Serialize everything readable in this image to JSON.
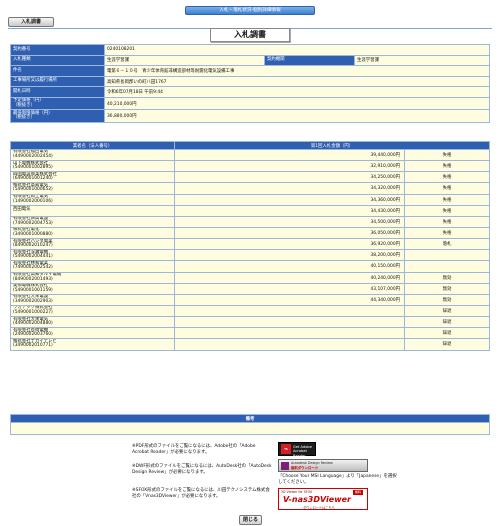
{
  "header": {
    "top_title": "入札・落札状況-個別詳細情報",
    "tab_label": "入札調書",
    "page_title": "入札調書"
  },
  "info": {
    "contract_no": {
      "label": "契約番号",
      "value": "0240108201"
    },
    "bid_method": {
      "label": "入札種類",
      "value": "生涯学習課"
    },
    "dept": {
      "label": "契約機関",
      "value": "生涯学習課"
    },
    "project": {
      "label": "件名",
      "value": "電第６－１０号　青少年体育館非構造部材等耐震化電気設備工事"
    },
    "location": {
      "label": "工事場所又は履行場所",
      "value": "高知県長岡郡いの町八田1767"
    },
    "bid_date": {
      "label": "開札日時",
      "value": "令和6年07月18日 午前9:44"
    },
    "planned_price": {
      "label": "予定価格（円）\n（税抜き）",
      "value": "40,210,000円"
    },
    "min_price": {
      "label": "最低制限価格（円）\n（税抜き）",
      "value": "36,880,000円"
    }
  },
  "bids": {
    "col_name": "業者名（法人番号）",
    "col_amount": "第1回入札金額（円）",
    "rows": [
      {
        "name": "有限会社福西電気",
        "corp": "(4490002002454)",
        "amount": "39,440,000円",
        "result": "失格"
      },
      {
        "name": "山下電機株式会社",
        "corp": "(5490001002895)",
        "amount": "32,910,000円",
        "result": "失格"
      },
      {
        "name": "四国電設興業株式会社",
        "corp": "(6490001001240)",
        "amount": "34,250,000円",
        "result": "失格"
      },
      {
        "name": "株式会社高知電気",
        "corp": "(5490001000652)",
        "amount": "34,320,000円",
        "result": "失格"
      },
      {
        "name": "有限会社岡上電気",
        "corp": "(1490002000106)",
        "amount": "34,360,000円",
        "result": "失格"
      },
      {
        "name": "西田電気",
        "corp": "",
        "amount": "34,430,000円",
        "result": "失格"
      },
      {
        "name": "有限会社興高電設",
        "corp": "(7490002004753)",
        "amount": "34,500,000円",
        "result": "失格"
      },
      {
        "name": "株式会社電化",
        "corp": "(3490001000880)",
        "amount": "36,050,000円",
        "result": "失格"
      },
      {
        "name": "有限会社ハシダ電業",
        "corp": "(8490002010247)",
        "amount": "36,920,000円",
        "result": "落札"
      },
      {
        "name": "有限会社深瀬電機",
        "corp": "(5490002004441)",
        "amount": "38,200,000円",
        "result": ""
      },
      {
        "name": "有限会社林和電業",
        "corp": "(7490002002542)",
        "amount": "40,150,000円",
        "result": ""
      },
      {
        "name": "有限会社高知ダルマ電機",
        "corp": "(8490002001493)",
        "amount": "40,240,000円",
        "result": "無効"
      },
      {
        "name": "美那電機株式会社",
        "corp": "(5490001001159)",
        "amount": "43,107,000円",
        "result": "無効"
      },
      {
        "name": "有限会社大栄電設",
        "corp": "(3490002002903)",
        "amount": "44,340,000円",
        "result": "無効"
      },
      {
        "name": "ワカテック株式会社",
        "corp": "(5490001000227)",
        "amount": "",
        "result": "辞退"
      },
      {
        "name": "有限会社大栄電気",
        "corp": "(4490002004880)",
        "amount": "",
        "result": "辞退"
      },
      {
        "name": "有限会社長崎電機",
        "corp": "(2490002003760)",
        "amount": "",
        "result": "辞退"
      },
      {
        "name": "株式会社ナカイテレビ",
        "corp": "(3490002010771)",
        "amount": "",
        "result": "辞退"
      }
    ]
  },
  "remarks": {
    "label": "備考",
    "value": ""
  },
  "notes": {
    "pdf": "※PDF形式のファイルをご覧になるには、Adobe社の「Adobe Acrobat Reader」が必要になります。",
    "dwf": "※DWF形式のファイルをご覧になるには、AutoDesk社の「AutoDesk Design Review」が必要になります。",
    "sfx": "※SFOX形式のファイルをご覧になるには、川田テクノシステム株式会社の「Vnas3DViewer」が必要になります。",
    "lang": "「Choose Your MSI Language」より「Japanese」を選択してください。"
  },
  "badges": {
    "acrobat_line1": "Get Adobe",
    "acrobat_line2": "Acrobat Reader",
    "dwf_line1": "Autodesk Design Review",
    "dwf_line2": "無料ダウンロード",
    "vnas_top": "3D Viewer for SFOX",
    "vnas_logo": "V-nas3DViewer",
    "vnas_dl": "ダウンロードはこちら",
    "vnas_badge": "無料"
  },
  "footer": {
    "close_label": "閉じる"
  },
  "colors": {
    "header_blue": "#2f5fb1",
    "cell_cream": "#fffde0",
    "vnas_red": "#cc0000"
  }
}
